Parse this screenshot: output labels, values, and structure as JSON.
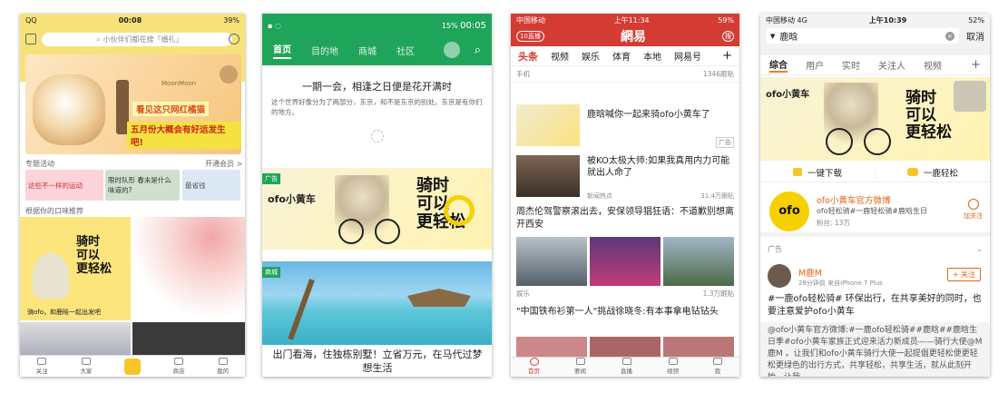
{
  "p1": {
    "status": {
      "carrier": "QQ",
      "time": "00:08",
      "battery": "39%"
    },
    "search_placeholder": "小伙伴们都在搜「婚礼」",
    "banner": {
      "brand": "MoonMoon",
      "line1": "看见这只网红橘猫",
      "line2": "五月份大概会有好运发生吧!"
    },
    "section1": {
      "title": "专题活动",
      "link": "开通会员 >"
    },
    "tiles": [
      {
        "label": "这些不一样的运动"
      },
      {
        "label": "限时队形 春末是什么味道的?"
      },
      {
        "label": "最省钱"
      }
    ],
    "section2": {
      "title": "根据你的口味推荐"
    },
    "card_caption": "骑ofo，和鹿晗一起出发吧",
    "tabs": [
      "关注",
      "大家",
      "",
      "商店",
      "我的"
    ]
  },
  "p2": {
    "status": {
      "battery": "15%",
      "time": "00:05"
    },
    "nav": [
      "首页",
      "目的地",
      "商城",
      "社区"
    ],
    "article_title": "一期一会，相逢之日便是花开满时",
    "article_body": "这个世界好像分为了两部分，东京，和不是东京的别处。东京是有你们的地方。",
    "ad_badge": "广告",
    "ad_brand": "ofo小黄车",
    "ad_slogan": [
      "骑时",
      "可以",
      "更轻松"
    ],
    "shop_badge": "商城",
    "shop_title": "出门看海，住独栋别墅！立省万元，在马代过梦想生活"
  },
  "p3": {
    "status": {
      "carrier": "中国移动",
      "time": "上午11:34",
      "battery": "59%"
    },
    "live_badge": "10直播",
    "logo": "網易",
    "search_label": "搜",
    "tabs": [
      "头条",
      "视频",
      "娱乐",
      "体育",
      "本地",
      "网易号"
    ],
    "prev_meta": {
      "source": "手机",
      "count": "1346跟贴"
    },
    "items": [
      {
        "title": "鹿晗喊你一起来骑ofo小黄车了",
        "tag": "广告"
      },
      {
        "title": "被KO太极大师:如果我真用内力可能就出人命了",
        "source": "新闻热点",
        "count": "31.4万跟贴"
      },
      {
        "title": "周杰伦驾警察滚出去，安保领导猖狂语：不道歉别想离开西安",
        "source": "娱乐",
        "count": "1.3万跟贴"
      },
      {
        "title": "\"中国铁布衫第一人\"挑战徐晓冬:有本事拿电钻钻头"
      }
    ],
    "bottom": [
      "首页",
      "要闻",
      "直播",
      "视频",
      "我"
    ]
  },
  "p4": {
    "status": {
      "carrier": "中国移动",
      "network": "4G",
      "time": "上午10:39",
      "battery": "52%"
    },
    "search_value": "鹿晗",
    "cancel": "取消",
    "tabs": [
      "综合",
      "用户",
      "实时",
      "关注人",
      "视频"
    ],
    "actions": [
      "一键下载",
      "一鹿轻松"
    ],
    "account": {
      "name": "ofo小黄车官方微博",
      "desc": "ofo轻松骑#一鹿轻松骑#鹿晗生日",
      "fans": "粉丝: 13万",
      "follow": "加关注"
    },
    "ad_label": "广告",
    "post": {
      "user": "M鹿M",
      "meta": "28分钟前 来自iPhone 7 Plus",
      "follow": "+ 关注",
      "text": "#一鹿ofo轻松骑# 环保出行，在共享美好的同时，也要注意爱护ofo小黄车",
      "repost": "@ofo小黄车官方微博:#一鹿ofo轻松骑##鹿晗##鹿晗生日季#ofo小黄车家族正式迎来活力新成员——骑行大使@M鹿M 。让我们和ofo小黄车骑行大使一起提倡更轻松便更轻松更绿色的出行方式，共享轻松，共享生活，就从此刻开始，让我"
    }
  }
}
